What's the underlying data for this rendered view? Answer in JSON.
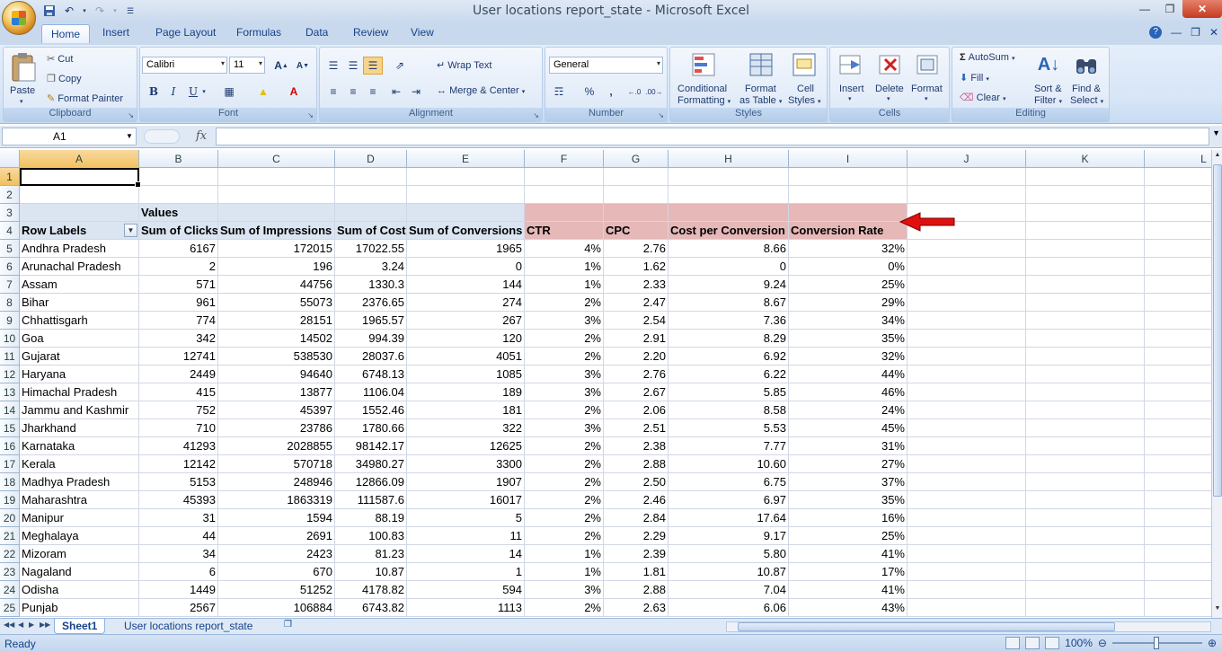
{
  "window": {
    "title": "User locations report_state - Microsoft Excel"
  },
  "tabs": [
    "Home",
    "Insert",
    "Page Layout",
    "Formulas",
    "Data",
    "Review",
    "View"
  ],
  "ribbon": {
    "clipboard": {
      "label": "Clipboard",
      "paste": "Paste",
      "cut": "Cut",
      "copy": "Copy",
      "format_painter": "Format Painter"
    },
    "font": {
      "label": "Font",
      "family": "Calibri",
      "size": "11",
      "bold": "B",
      "italic": "I",
      "underline": "U"
    },
    "alignment": {
      "label": "Alignment",
      "wrap_text": "Wrap Text",
      "merge_center": "Merge & Center"
    },
    "number": {
      "label": "Number",
      "format": "General",
      "percent": "%",
      "comma": ","
    },
    "styles": {
      "label": "Styles",
      "conditional_1": "Conditional",
      "conditional_2": "Formatting",
      "format_table_1": "Format",
      "format_table_2": "as Table",
      "cell_styles_1": "Cell",
      "cell_styles_2": "Styles"
    },
    "cells": {
      "label": "Cells",
      "insert": "Insert",
      "delete": "Delete",
      "format": "Format"
    },
    "editing": {
      "label": "Editing",
      "autosum": "AutoSum",
      "fill": "Fill",
      "clear": "Clear",
      "sort_1": "Sort &",
      "sort_2": "Filter",
      "find_1": "Find &",
      "find_2": "Select"
    }
  },
  "formula_bar": {
    "name_box": "A1",
    "fx": "fx",
    "value": ""
  },
  "columns": [
    "A",
    "B",
    "C",
    "D",
    "E",
    "F",
    "G",
    "H",
    "I",
    "J",
    "K",
    "L"
  ],
  "rows": [
    {
      "n": "1",
      "cells": [
        "",
        "",
        "",
        "",
        "",
        "",
        "",
        "",
        ""
      ]
    },
    {
      "n": "2",
      "cells": [
        "",
        "",
        "",
        "",
        "",
        "",
        "",
        "",
        ""
      ]
    },
    {
      "n": "3",
      "cells": [
        "",
        "Values",
        "",
        "",
        "",
        "",
        "",
        "",
        ""
      ]
    },
    {
      "n": "4",
      "cells": [
        "Row Labels",
        "Sum of Clicks",
        "Sum of Impressions",
        "Sum of Cost",
        "Sum of Conversions",
        "CTR",
        "CPC",
        "Cost per Conversion",
        "Conversion Rate"
      ]
    },
    {
      "n": "5",
      "cells": [
        "Andhra Pradesh",
        "6167",
        "172015",
        "17022.55",
        "1965",
        "4%",
        "2.76",
        "8.66",
        "32%"
      ]
    },
    {
      "n": "6",
      "cells": [
        "Arunachal Pradesh",
        "2",
        "196",
        "3.24",
        "0",
        "1%",
        "1.62",
        "0",
        "0%"
      ]
    },
    {
      "n": "7",
      "cells": [
        "Assam",
        "571",
        "44756",
        "1330.3",
        "144",
        "1%",
        "2.33",
        "9.24",
        "25%"
      ]
    },
    {
      "n": "8",
      "cells": [
        "Bihar",
        "961",
        "55073",
        "2376.65",
        "274",
        "2%",
        "2.47",
        "8.67",
        "29%"
      ]
    },
    {
      "n": "9",
      "cells": [
        "Chhattisgarh",
        "774",
        "28151",
        "1965.57",
        "267",
        "3%",
        "2.54",
        "7.36",
        "34%"
      ]
    },
    {
      "n": "10",
      "cells": [
        "Goa",
        "342",
        "14502",
        "994.39",
        "120",
        "2%",
        "2.91",
        "8.29",
        "35%"
      ]
    },
    {
      "n": "11",
      "cells": [
        "Gujarat",
        "12741",
        "538530",
        "28037.6",
        "4051",
        "2%",
        "2.20",
        "6.92",
        "32%"
      ]
    },
    {
      "n": "12",
      "cells": [
        "Haryana",
        "2449",
        "94640",
        "6748.13",
        "1085",
        "3%",
        "2.76",
        "6.22",
        "44%"
      ]
    },
    {
      "n": "13",
      "cells": [
        "Himachal Pradesh",
        "415",
        "13877",
        "1106.04",
        "189",
        "3%",
        "2.67",
        "5.85",
        "46%"
      ]
    },
    {
      "n": "14",
      "cells": [
        "Jammu and Kashmir",
        "752",
        "45397",
        "1552.46",
        "181",
        "2%",
        "2.06",
        "8.58",
        "24%"
      ]
    },
    {
      "n": "15",
      "cells": [
        "Jharkhand",
        "710",
        "23786",
        "1780.66",
        "322",
        "3%",
        "2.51",
        "5.53",
        "45%"
      ]
    },
    {
      "n": "16",
      "cells": [
        "Karnataka",
        "41293",
        "2028855",
        "98142.17",
        "12625",
        "2%",
        "2.38",
        "7.77",
        "31%"
      ]
    },
    {
      "n": "17",
      "cells": [
        "Kerala",
        "12142",
        "570718",
        "34980.27",
        "3300",
        "2%",
        "2.88",
        "10.60",
        "27%"
      ]
    },
    {
      "n": "18",
      "cells": [
        "Madhya Pradesh",
        "5153",
        "248946",
        "12866.09",
        "1907",
        "2%",
        "2.50",
        "6.75",
        "37%"
      ]
    },
    {
      "n": "19",
      "cells": [
        "Maharashtra",
        "45393",
        "1863319",
        "111587.6",
        "16017",
        "2%",
        "2.46",
        "6.97",
        "35%"
      ]
    },
    {
      "n": "20",
      "cells": [
        "Manipur",
        "31",
        "1594",
        "88.19",
        "5",
        "2%",
        "2.84",
        "17.64",
        "16%"
      ]
    },
    {
      "n": "21",
      "cells": [
        "Meghalaya",
        "44",
        "2691",
        "100.83",
        "11",
        "2%",
        "2.29",
        "9.17",
        "25%"
      ]
    },
    {
      "n": "22",
      "cells": [
        "Mizoram",
        "34",
        "2423",
        "81.23",
        "14",
        "1%",
        "2.39",
        "5.80",
        "41%"
      ]
    },
    {
      "n": "23",
      "cells": [
        "Nagaland",
        "6",
        "670",
        "10.87",
        "1",
        "1%",
        "1.81",
        "10.87",
        "17%"
      ]
    },
    {
      "n": "24",
      "cells": [
        "Odisha",
        "1449",
        "51252",
        "4178.82",
        "594",
        "3%",
        "2.88",
        "7.04",
        "41%"
      ]
    },
    {
      "n": "25",
      "cells": [
        "Punjab",
        "2567",
        "106884",
        "6743.82",
        "1113",
        "2%",
        "2.63",
        "6.06",
        "43%"
      ]
    }
  ],
  "sheets": [
    "Sheet1",
    "User locations report_state"
  ],
  "status": {
    "text": "Ready",
    "zoom": "100%"
  },
  "colors": {
    "highlight_pink": "#e6b8b7",
    "pivot_header": "#dbe5f1",
    "arrow": "#e01010"
  }
}
